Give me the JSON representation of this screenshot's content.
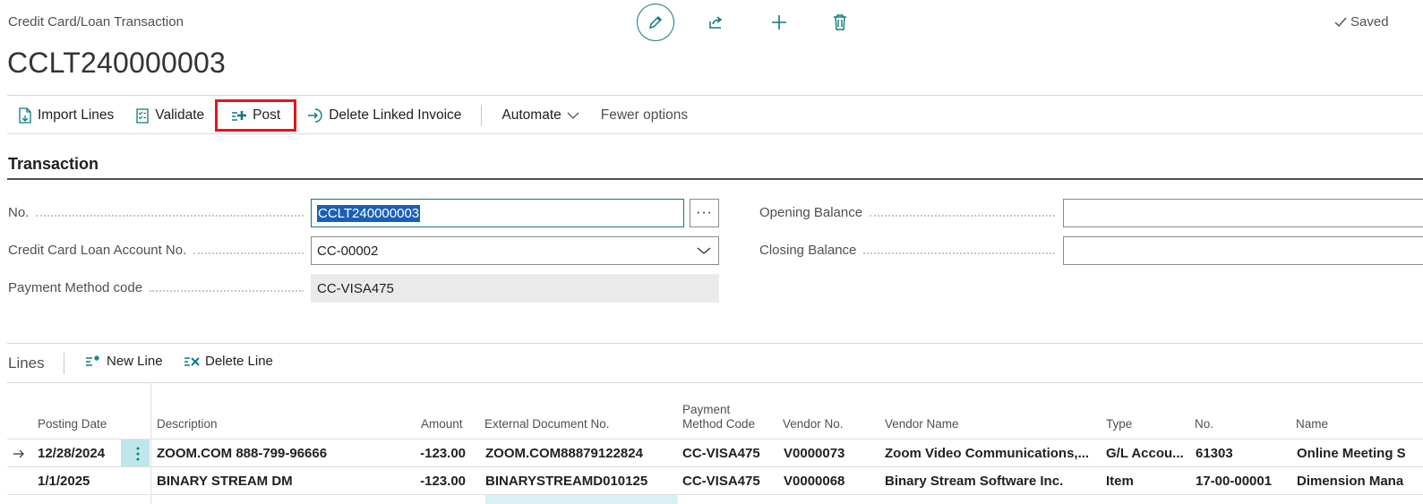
{
  "header": {
    "breadcrumb": "Credit Card/Loan Transaction",
    "record_id": "CCLT240000003",
    "saved_label": "Saved"
  },
  "actions": {
    "import_lines": "Import Lines",
    "validate": "Validate",
    "post": "Post",
    "delete_linked_invoice": "Delete Linked Invoice",
    "automate": "Automate",
    "fewer_options": "Fewer options"
  },
  "transaction": {
    "section_title": "Transaction",
    "no_label": "No.",
    "no_value": "CCLT240000003",
    "account_label": "Credit Card Loan Account No.",
    "account_value": "CC-00002",
    "payment_method_label": "Payment Method code",
    "payment_method_value": "CC-VISA475",
    "opening_balance_label": "Opening Balance",
    "opening_balance_value": "",
    "closing_balance_label": "Closing Balance",
    "closing_balance_value": "",
    "ellipsis": "···"
  },
  "lines": {
    "title": "Lines",
    "new_line": "New Line",
    "delete_line": "Delete Line",
    "columns": {
      "posting_date": "Posting Date",
      "description": "Description",
      "amount": "Amount",
      "external_doc": "External Document No.",
      "payment_method_1": "Payment",
      "payment_method_2": "Method Code",
      "vendor_no": "Vendor No.",
      "vendor_name": "Vendor Name",
      "type": "Type",
      "no": "No.",
      "name": "Name"
    },
    "rows": [
      {
        "posting_date": "12/28/2024",
        "description": "ZOOM.COM 888-799-96666",
        "amount": "-123.00",
        "external_doc": "ZOOM.COM88879122824",
        "payment_method": "CC-VISA475",
        "vendor_no": "V0000073",
        "vendor_name": "Zoom Video Communications,...",
        "type": "G/L Accou...",
        "no": "61303",
        "name": "Online Meeting S"
      },
      {
        "posting_date": "1/1/2025",
        "description": "BINARY STREAM DM",
        "amount": "-123.00",
        "external_doc": "BINARYSTREAMD010125",
        "payment_method": "CC-VISA475",
        "vendor_no": "V0000068",
        "vendor_name": "Binary Stream Software Inc.",
        "type": "Item",
        "no": "17-00-00001",
        "name": "Dimension Mana"
      }
    ]
  },
  "colors": {
    "accent": "#0f7b80",
    "highlight_border": "#e4141b",
    "selection": "#1a5fb4"
  }
}
